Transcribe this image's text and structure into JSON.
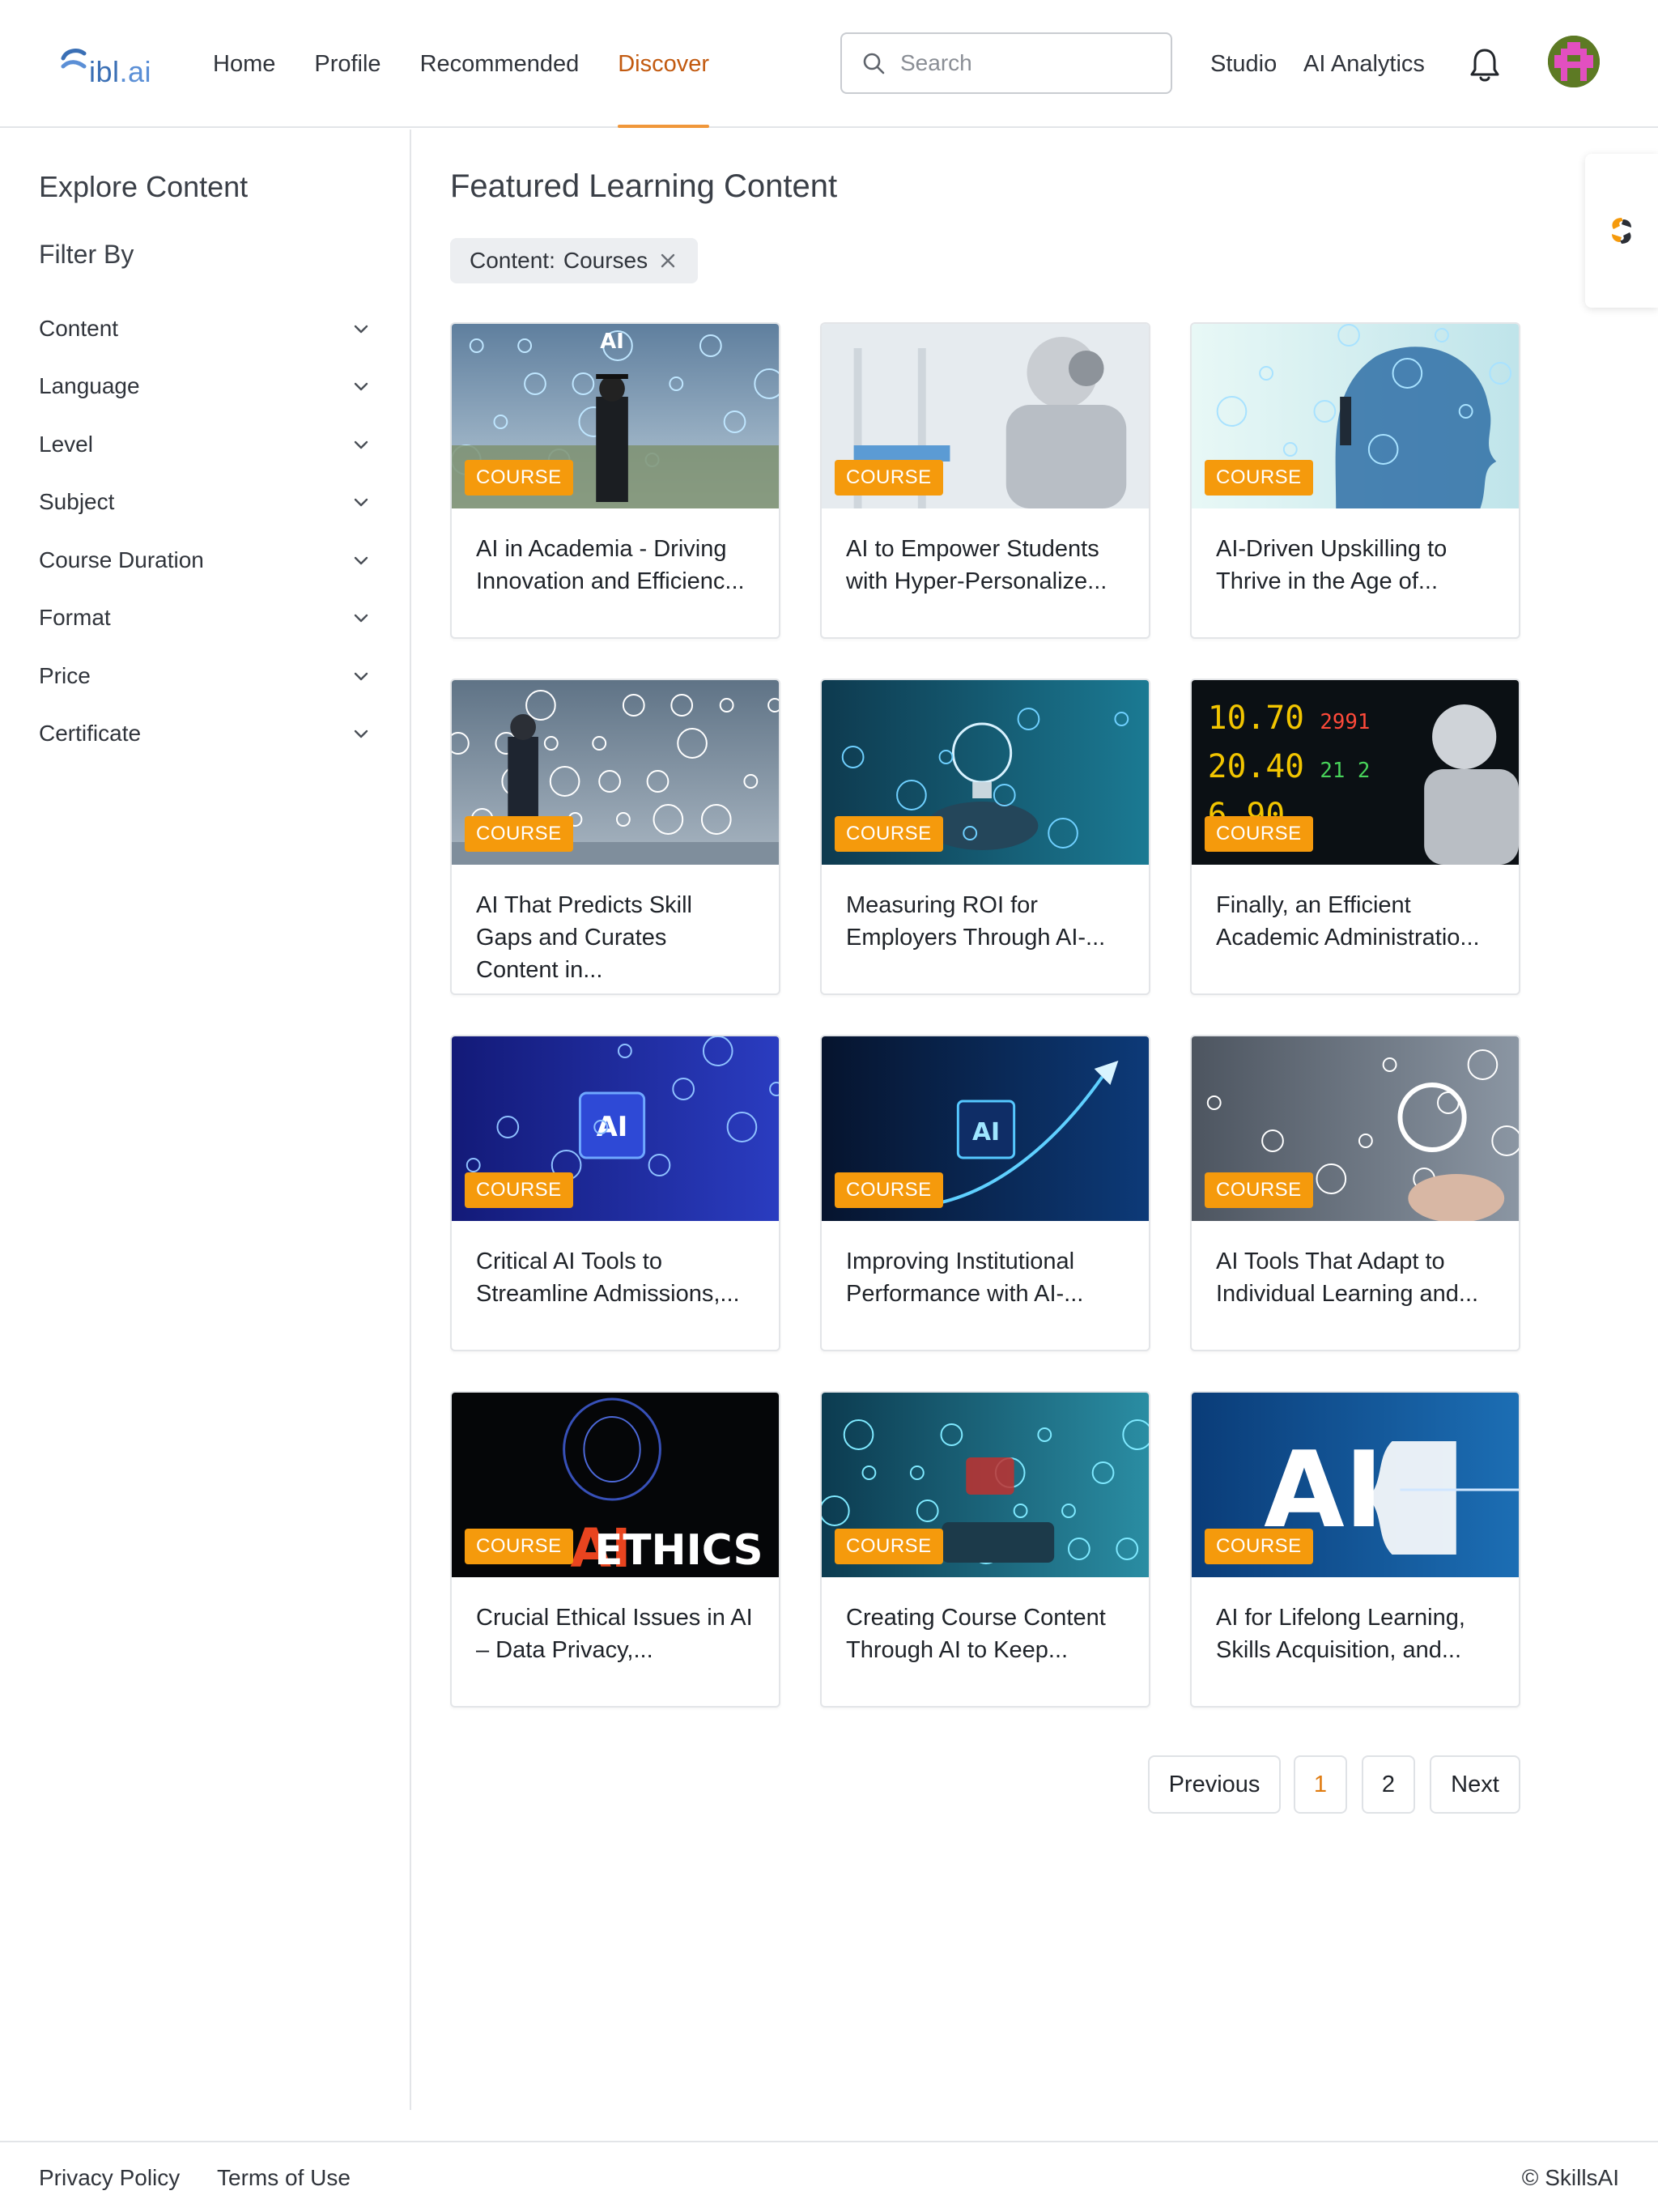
{
  "header": {
    "logo_text": "ibl",
    "logo_suffix": ".ai",
    "nav": [
      {
        "label": "Home",
        "active": false
      },
      {
        "label": "Profile",
        "active": false
      },
      {
        "label": "Recommended",
        "active": false
      },
      {
        "label": "Discover",
        "active": true
      }
    ],
    "search_placeholder": "Search",
    "studio_label": "Studio",
    "analytics_label": "AI Analytics"
  },
  "sidebar": {
    "title": "Explore Content",
    "filter_heading": "Filter By",
    "filters": [
      "Content",
      "Language",
      "Level",
      "Subject",
      "Course Duration",
      "Format",
      "Price",
      "Certificate"
    ]
  },
  "main": {
    "title": "Featured Learning Content",
    "chip": {
      "label": "Content:",
      "value": "Courses"
    },
    "badge_label": "COURSE",
    "cards": [
      {
        "title": "AI in Academia - Driving Innovation and Efficienc...",
        "image": "graduate-city-icons"
      },
      {
        "title": "AI to Empower Students with Hyper-Personalize...",
        "image": "robot-headphones"
      },
      {
        "title": "AI-Driven Upskilling to Thrive in the Age of...",
        "image": "head-silhouette"
      },
      {
        "title": "AI That Predicts Skill Gaps and Curates Content in...",
        "image": "man-whiteboard-sketch"
      },
      {
        "title": "Measuring ROI for Employers Through AI-...",
        "image": "lightbulb-hand"
      },
      {
        "title": "Finally, an Efficient Academic Administratio...",
        "image": "robot-stock-board"
      },
      {
        "title": "Critical AI Tools to Streamline Admissions,...",
        "image": "ai-chip-blue"
      },
      {
        "title": "Improving Institutional Performance with AI-...",
        "image": "ai-chip-rocket"
      },
      {
        "title": "AI Tools That Adapt to Individual Learning and...",
        "image": "gears-hand"
      },
      {
        "title": "Crucial Ethical Issues in AI – Data Privacy,...",
        "image": "ai-ethics-brain"
      },
      {
        "title": "Creating Course Content Through AI to Keep...",
        "image": "tablet-hologram"
      },
      {
        "title": "AI for Lifelong Learning, Skills Acquisition, and...",
        "image": "ai-profile-circuit"
      }
    ]
  },
  "pagination": {
    "previous": "Previous",
    "pages": [
      "1",
      "2"
    ],
    "current": "1",
    "next": "Next"
  },
  "footer": {
    "privacy": "Privacy Policy",
    "terms": "Terms of Use",
    "copyright": "© SkillsAI"
  },
  "colors": {
    "accent": "#e07b10",
    "badge": "#f59a0c",
    "logo": "#3a6fb5",
    "border": "#e3e5e8"
  },
  "icons": [
    "search-icon",
    "bell-icon",
    "chevron-down-icon",
    "close-icon",
    "widget-logo-icon"
  ],
  "image_art_text": {
    "ethics": "ETHICS",
    "ai": "AI"
  }
}
